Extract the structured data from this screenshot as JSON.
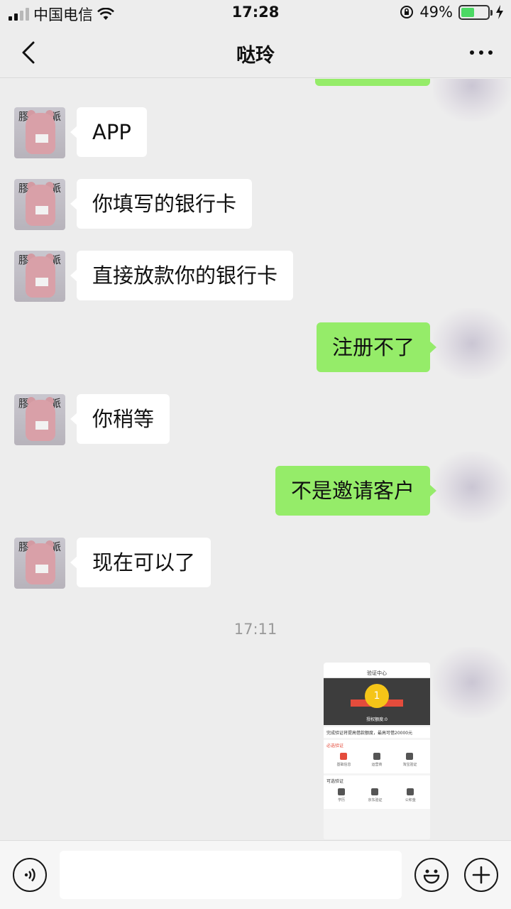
{
  "status_bar": {
    "carrier": "中国电信",
    "time": "17:28",
    "battery_percent": "49%",
    "battery_level": 0.49
  },
  "nav": {
    "title": "哒玲"
  },
  "messages": [
    {
      "side": "in",
      "text": "APP"
    },
    {
      "side": "in",
      "text": "你填写的银行卡"
    },
    {
      "side": "in",
      "text": "直接放款你的银行卡"
    },
    {
      "side": "out",
      "text": "注册不了"
    },
    {
      "side": "in",
      "text": "你稍等"
    },
    {
      "side": "out",
      "text": "不是邀请客户"
    },
    {
      "side": "in",
      "text": "现在可以了"
    }
  ],
  "timestamp": "17:11",
  "avatar_chars": {
    "left": "膠",
    "right": "眽",
    "tag": "1800"
  },
  "image_message": {
    "nav_title": "验证中心",
    "coin_value": "1",
    "quota": "授权额度:0",
    "notice": "完成验证将提高借款额度，最高可借20000元",
    "required_title": "必选验证",
    "required_items": [
      "基础信息",
      "运营商",
      "淘宝验证"
    ],
    "optional_title": "可选验证",
    "optional_items": [
      "学历",
      "京东验证",
      "公积金"
    ]
  },
  "input_bar": {
    "voice": "voice-icon",
    "emoji": "emoji-icon",
    "add": "plus-icon"
  }
}
